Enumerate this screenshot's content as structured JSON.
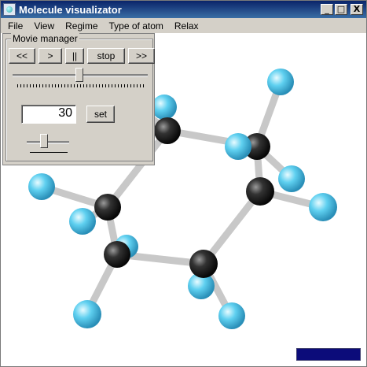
{
  "window": {
    "title": "Molecule visualizator",
    "buttons": [
      "_",
      "□",
      "X"
    ]
  },
  "menu": [
    "File",
    "View",
    "Regime",
    "Type of atom",
    "Relax"
  ],
  "movie_manager": {
    "title": "Movie manager",
    "buttons": [
      "<<",
      ">",
      "||",
      "stop",
      ">>"
    ],
    "frame_value": "30",
    "set_label": "set"
  },
  "scene": {
    "background": "#ffffff",
    "atom_colors": {
      "carbon": "#222222",
      "hydrogen": "#55ccee"
    },
    "bond_color": "#d0d0d0"
  },
  "icons": {
    "app": "molecule-app-icon",
    "minimize": "minimize-icon",
    "maximize": "maximize-icon",
    "close": "close-icon"
  },
  "colors": {
    "titlebar_start": "#0a246a",
    "titlebar_end": "#3a6ea5",
    "chrome": "#d4d0c8",
    "status_bar": "#0c0c7a"
  }
}
